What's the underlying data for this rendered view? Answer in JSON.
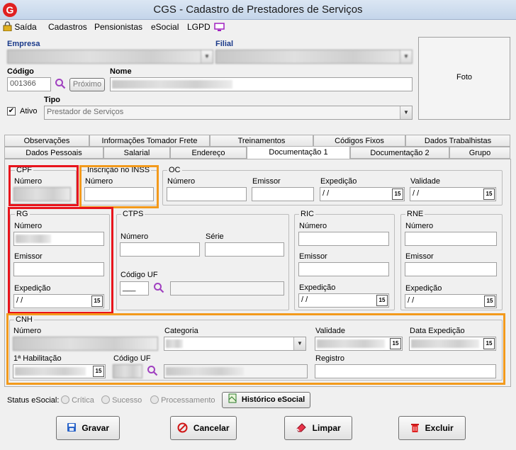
{
  "window": {
    "title": "CGS - Cadastro de Prestadores de Serviços",
    "app_icon": "G"
  },
  "menu": {
    "saida": "Saída",
    "cadastros": "Cadastros",
    "pensionistas": "Pensionistas",
    "esocial": "eSocial",
    "lgpd": "LGPD"
  },
  "header": {
    "empresa_label": "Empresa",
    "filial_label": "Filial",
    "codigo_label": "Código",
    "codigo_value": "001366",
    "proximo_label": "Próximo",
    "nome_label": "Nome",
    "ativo_label": "Ativo",
    "tipo_label": "Tipo",
    "tipo_value": "Prestador de Serviços",
    "foto_label": "Foto"
  },
  "tabs_row1": [
    "Observações",
    "Informações Tomador Frete",
    "Treinamentos",
    "Códigos Fixos",
    "Dados Trabalhistas"
  ],
  "tabs_row2": [
    "Dados Pessoais",
    "Salarial",
    "Endereço",
    "Documentação 1",
    "Documentação 2",
    "Grupo"
  ],
  "doc": {
    "cpf_title": "CPF",
    "cpf_numero_label": "Número",
    "inss_title": "Inscrição no INSS",
    "inss_numero_label": "Número",
    "oc_title": "OC",
    "oc_numero_label": "Número",
    "oc_emissor_label": "Emissor",
    "oc_expedicao_label": "Expedição",
    "oc_expedicao_value": " / /",
    "oc_validade_label": "Validade",
    "oc_validade_value": " / /",
    "rg_title": "RG",
    "rg_numero_label": "Número",
    "rg_emissor_label": "Emissor",
    "rg_expedicao_label": "Expedição",
    "rg_expedicao_value": " / /",
    "ctps_title": "CTPS",
    "ctps_numero_label": "Número",
    "ctps_serie_label": "Série",
    "ctps_codigo_uf_label": "Código UF",
    "ctps_codigo_uf_value": "___",
    "ric_title": "RIC",
    "ric_numero_label": "Número",
    "ric_emissor_label": "Emissor",
    "ric_expedicao_label": "Expedição",
    "ric_expedicao_value": " / /",
    "rne_title": "RNE",
    "rne_numero_label": "Número",
    "rne_emissor_label": "Emissor",
    "rne_expedicao_label": "Expedição",
    "rne_expedicao_value": " / /",
    "cnh_title": "CNH",
    "cnh_numero_label": "Número",
    "cnh_categoria_label": "Categoria",
    "cnh_validade_label": "Validade",
    "cnh_data_expedicao_label": "Data Expedição",
    "cnh_habilitacao_label": "1ª Habilitação",
    "cnh_codigo_uf_label": "Código UF",
    "cnh_registro_label": "Registro",
    "calendar_glyph": "15"
  },
  "status": {
    "label": "Status eSocial:",
    "critica": "Crítica",
    "sucesso": "Sucesso",
    "processamento": "Processamento",
    "historico_button": "Histórico eSocial"
  },
  "actions": {
    "gravar": "Gravar",
    "cancelar": "Cancelar",
    "limpar": "Limpar",
    "excluir": "Excluir"
  },
  "colors": {
    "highlight_red": "#e8141c",
    "highlight_orange": "#f39a1c",
    "label_blue": "#1a3a8a"
  }
}
